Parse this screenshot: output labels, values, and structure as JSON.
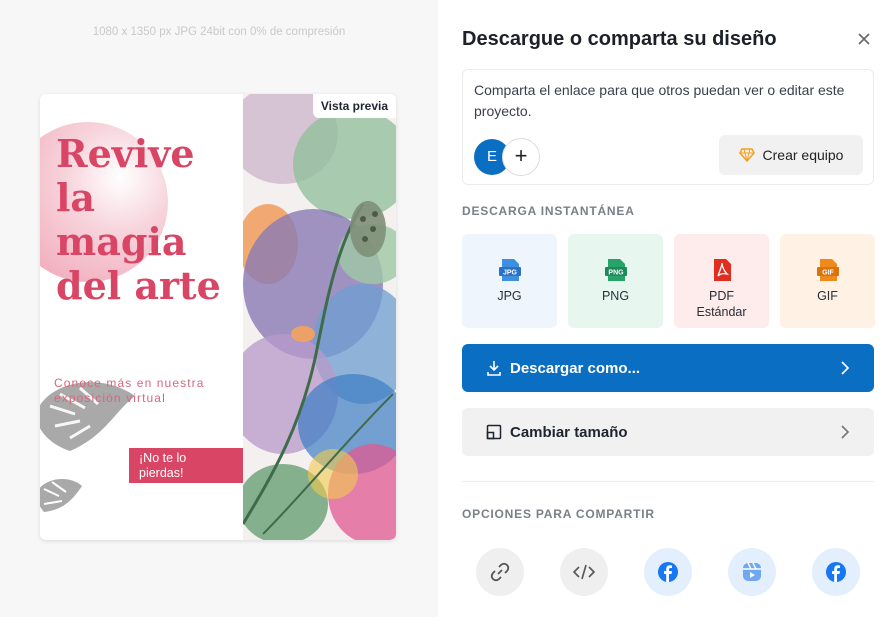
{
  "preview": {
    "meta": "1080 x 1350 px JPG 24bit con 0% de compresión",
    "badge": "Vista previa",
    "headline": [
      "Revive",
      "la",
      "magia",
      "del arte"
    ],
    "subtext": [
      "Conoce más en nuestra",
      "exposición virtual"
    ],
    "cta": [
      "¡No te lo",
      "pierdas!"
    ]
  },
  "panel": {
    "title": "Descargue o comparta su diseño",
    "share_text": "Comparta el enlace para que otros puedan ver o editar este proyecto.",
    "avatar_initial": "E",
    "add_symbol": "+",
    "team_button": "Crear equipo",
    "instant_label": "DESCARGA INSTANTÁNEA",
    "formats": [
      {
        "badge": "JPG",
        "label": "JPG",
        "sub": "",
        "bg": "#eef5fd",
        "color": "#3d8fe0"
      },
      {
        "badge": "PNG",
        "label": "PNG",
        "sub": "",
        "bg": "#e7f7ef",
        "color": "#27a36a"
      },
      {
        "badge": "",
        "label": "PDF",
        "sub": "Estándar",
        "bg": "#fdeceb",
        "color": "#e02d20"
      },
      {
        "badge": "GIF",
        "label": "GIF",
        "sub": "",
        "bg": "#fff1e3",
        "color": "#f08a1d"
      }
    ],
    "download_as": "Descargar como...",
    "resize": "Cambiar tamaño",
    "share_label": "OPCIONES PARA COMPARTIR",
    "share_icons": [
      "link-icon",
      "embed-code-icon",
      "facebook-icon",
      "reels-icon",
      "facebook-icon"
    ]
  },
  "colors": {
    "accent_blue": "#0a6fc2",
    "poster_pink": "#d94565"
  }
}
